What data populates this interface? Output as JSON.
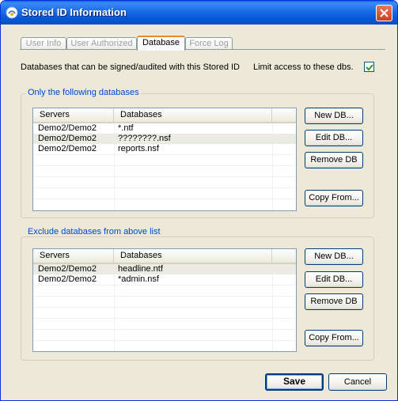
{
  "window": {
    "title": "Stored ID Information"
  },
  "tabs": [
    {
      "label": "User Info",
      "active": false
    },
    {
      "label": "User Authorized",
      "active": false
    },
    {
      "label": "Database",
      "active": true
    },
    {
      "label": "Force Log",
      "active": false
    }
  ],
  "main": {
    "description": "Databases that can be signed/audited with this Stored ID",
    "limit_label": "Limit access to these dbs.",
    "limit_checked": true
  },
  "include_group": {
    "title": "Only the following databases",
    "columns": [
      "Servers",
      "Databases"
    ],
    "rows": [
      {
        "server": "Demo2/Demo2",
        "database": "*.ntf"
      },
      {
        "server": "Demo2/Demo2",
        "database": "????????.nsf"
      },
      {
        "server": "Demo2/Demo2",
        "database": "reports.nsf"
      }
    ],
    "buttons": {
      "new_db": "New DB...",
      "edit_db": "Edit DB...",
      "remove_db": "Remove DB",
      "copy_from": "Copy From..."
    }
  },
  "exclude_group": {
    "title": "Exclude databases from above list",
    "columns": [
      "Servers",
      "Databases"
    ],
    "rows": [
      {
        "server": "Demo2/Demo2",
        "database": "headline.ntf"
      },
      {
        "server": "Demo2/Demo2",
        "database": "*admin.nsf"
      }
    ],
    "buttons": {
      "new_db": "New DB...",
      "edit_db": "Edit DB...",
      "remove_db": "Remove DB",
      "copy_from": "Copy From..."
    }
  },
  "footer": {
    "save_label": "Save",
    "cancel_label": "Cancel"
  },
  "colors": {
    "titlebar": "#0756d6",
    "group_title": "#0046d5",
    "window_bg": "#ece9d8"
  }
}
